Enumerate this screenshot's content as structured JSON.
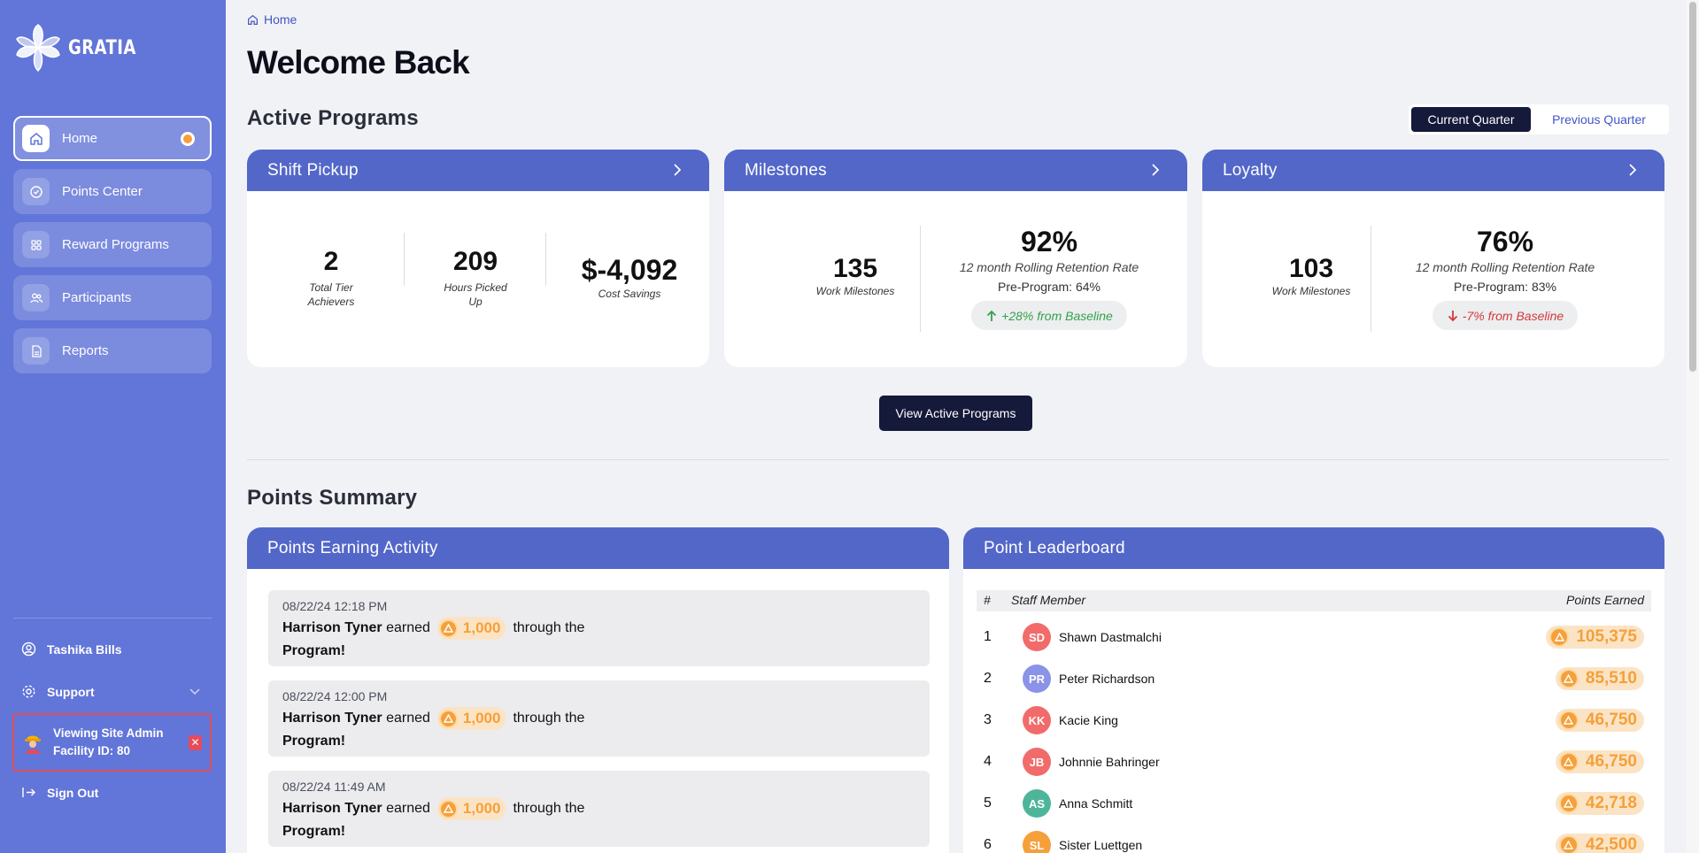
{
  "sidebar": {
    "brand": "GRATIA",
    "nav": [
      {
        "label": "Home",
        "icon": "home-icon",
        "active": true
      },
      {
        "label": "Points Center",
        "icon": "target-icon"
      },
      {
        "label": "Reward Programs",
        "icon": "grid-icon"
      },
      {
        "label": "Participants",
        "icon": "users-icon"
      },
      {
        "label": "Reports",
        "icon": "document-icon"
      }
    ],
    "user_name": "Tashika Bills",
    "support_label": "Support",
    "admin_line1": "Viewing Site Admin",
    "admin_line2": "Facility ID: 80",
    "admin_close": "✕",
    "sign_out": "Sign Out"
  },
  "breadcrumb": "Home",
  "page_title": "Welcome Back",
  "active_programs": {
    "title": "Active Programs",
    "toggle": {
      "current": "Current Quarter",
      "previous": "Previous Quarter"
    },
    "shift_pickup": {
      "title": "Shift Pickup",
      "stats": [
        {
          "value": "2",
          "label_1": "Total Tier",
          "label_2": "Achievers"
        },
        {
          "value": "209",
          "label_1": "Hours Picked",
          "label_2": "Up"
        },
        {
          "value": "$-4,092",
          "label_1": "Cost Savings",
          "label_2": ""
        }
      ]
    },
    "milestones": {
      "title": "Milestones",
      "count": "135",
      "count_label": "Work Milestones",
      "rate": "92%",
      "rate_label": "12 month Rolling Retention Rate",
      "pre": "Pre-Program: 64%",
      "change": "+28% from Baseline"
    },
    "loyalty": {
      "title": "Loyalty",
      "count": "103",
      "count_label": "Work Milestones",
      "rate": "76%",
      "rate_label": "12 month Rolling Retention Rate",
      "pre": "Pre-Program: 83%",
      "change": "-7% from Baseline"
    },
    "view_button": "View Active Programs"
  },
  "points_summary": {
    "title": "Points Summary",
    "activity": {
      "title": "Points Earning Activity",
      "items": [
        {
          "date": "08/22/24 12:18 PM",
          "name": "Harrison Tyner",
          "verb": "earned",
          "points": "1,000",
          "through": "through the",
          "program": "Program!"
        },
        {
          "date": "08/22/24 12:00 PM",
          "name": "Harrison Tyner",
          "verb": "earned",
          "points": "1,000",
          "through": "through the",
          "program": "Program!"
        },
        {
          "date": "08/22/24 11:49 AM",
          "name": "Harrison Tyner",
          "verb": "earned",
          "points": "1,000",
          "through": "through the",
          "program": "Program!"
        }
      ]
    },
    "leaderboard": {
      "title": "Point Leaderboard",
      "col_rank": "#",
      "col_member": "Staff Member",
      "col_points": "Points Earned",
      "rows": [
        {
          "rank": "1",
          "initials": "SD",
          "name": "Shawn Dastmalchi",
          "points": "105,375",
          "color": "#f26b6b"
        },
        {
          "rank": "2",
          "initials": "PR",
          "name": "Peter Richardson",
          "points": "85,510",
          "color": "#8a93e8"
        },
        {
          "rank": "3",
          "initials": "KK",
          "name": "Kacie King",
          "points": "46,750",
          "color": "#f26b6b"
        },
        {
          "rank": "4",
          "initials": "JB",
          "name": "Johnnie Bahringer",
          "points": "46,750",
          "color": "#f26b6b"
        },
        {
          "rank": "5",
          "initials": "AS",
          "name": "Anna Schmitt",
          "points": "42,718",
          "color": "#4fb59a"
        },
        {
          "rank": "6",
          "initials": "SL",
          "name": "Sister Luettgen",
          "points": "42,500",
          "color": "#f5a03a"
        }
      ]
    }
  },
  "colors": {
    "sidebar": "#6275d8",
    "card_header": "#5367c9",
    "accent_orange": "#f5a03a",
    "dark_button": "#15193a"
  }
}
